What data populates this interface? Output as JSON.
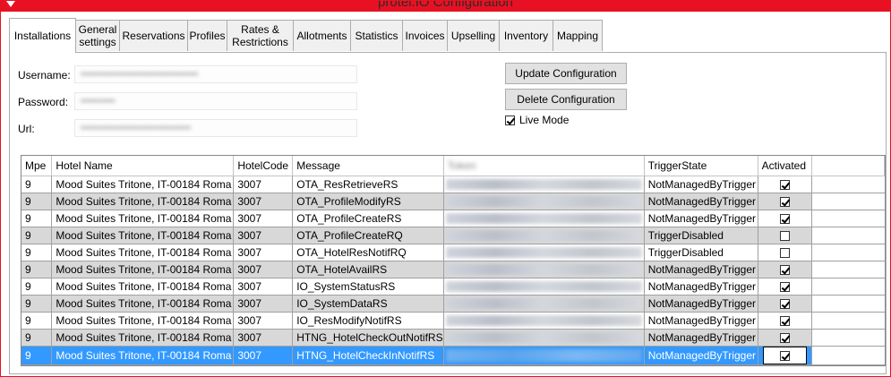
{
  "window": {
    "title": "protel.IO Configuration"
  },
  "tabs": [
    {
      "label": "Installations",
      "active": true
    },
    {
      "label": "General\nsettings"
    },
    {
      "label": "Reservations"
    },
    {
      "label": "Profiles"
    },
    {
      "label": "Rates &\nRestrictions"
    },
    {
      "label": "Allotments"
    },
    {
      "label": "Statistics"
    },
    {
      "label": "Invoices"
    },
    {
      "label": "Upselling"
    },
    {
      "label": "Inventory"
    },
    {
      "label": "Mapping"
    }
  ],
  "form": {
    "username_label": "Username:",
    "password_label": "Password:",
    "url_label": "Url:",
    "update_button": "Update Configuration",
    "delete_button": "Delete Configuration",
    "live_mode_label": "Live Mode",
    "live_mode_checked": true
  },
  "grid": {
    "columns": [
      "Mpe",
      "Hotel Name",
      "HotelCode",
      "Message",
      "Token",
      "TriggerState",
      "Activated"
    ],
    "rows": [
      {
        "mpe": "9",
        "hotel": "Mood Suites Tritone, IT-00184 Roma",
        "code": "3007",
        "message": "OTA_ResRetrieveRS",
        "trigger": "NotManagedByTrigger",
        "activated": true
      },
      {
        "mpe": "9",
        "hotel": "Mood Suites Tritone, IT-00184 Roma",
        "code": "3007",
        "message": "OTA_ProfileModifyRS",
        "trigger": "NotManagedByTrigger",
        "activated": true
      },
      {
        "mpe": "9",
        "hotel": "Mood Suites Tritone, IT-00184 Roma",
        "code": "3007",
        "message": "OTA_ProfileCreateRS",
        "trigger": "NotManagedByTrigger",
        "activated": true
      },
      {
        "mpe": "9",
        "hotel": "Mood Suites Tritone, IT-00184 Roma",
        "code": "3007",
        "message": "OTA_ProfileCreateRQ",
        "trigger": "TriggerDisabled",
        "activated": false
      },
      {
        "mpe": "9",
        "hotel": "Mood Suites Tritone, IT-00184 Roma",
        "code": "3007",
        "message": "OTA_HotelResNotifRQ",
        "trigger": "TriggerDisabled",
        "activated": false
      },
      {
        "mpe": "9",
        "hotel": "Mood Suites Tritone, IT-00184 Roma",
        "code": "3007",
        "message": "OTA_HotelAvailRS",
        "trigger": "NotManagedByTrigger",
        "activated": true
      },
      {
        "mpe": "9",
        "hotel": "Mood Suites Tritone, IT-00184 Roma",
        "code": "3007",
        "message": "IO_SystemStatusRS",
        "trigger": "NotManagedByTrigger",
        "activated": true
      },
      {
        "mpe": "9",
        "hotel": "Mood Suites Tritone, IT-00184 Roma",
        "code": "3007",
        "message": "IO_SystemDataRS",
        "trigger": "NotManagedByTrigger",
        "activated": true
      },
      {
        "mpe": "9",
        "hotel": "Mood Suites Tritone, IT-00184 Roma",
        "code": "3007",
        "message": "IO_ResModifyNotifRS",
        "trigger": "NotManagedByTrigger",
        "activated": true
      },
      {
        "mpe": "9",
        "hotel": "Mood Suites Tritone, IT-00184 Roma",
        "code": "3007",
        "message": "HTNG_HotelCheckOutNotifRS",
        "trigger": "NotManagedByTrigger",
        "activated": true
      },
      {
        "mpe": "9",
        "hotel": "Mood Suites Tritone, IT-00184 Roma",
        "code": "3007",
        "message": "HTNG_HotelCheckInNotifRS",
        "trigger": "NotManagedByTrigger",
        "activated": true,
        "selected": true
      }
    ]
  },
  "colors": {
    "accent": "#e81123",
    "selection": "#3399ff",
    "alt_row": "#d8d8d8"
  }
}
